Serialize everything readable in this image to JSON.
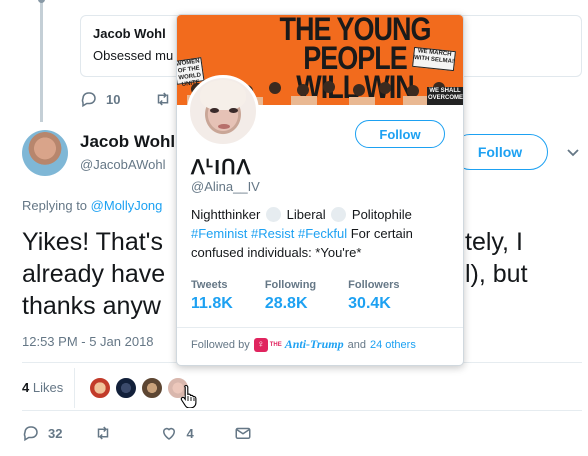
{
  "quoted_tweet": {
    "author": "Jacob Wohl",
    "text": "Obsessed mu"
  },
  "top_actions": {
    "replies": "10"
  },
  "tweet": {
    "author_name": "Jacob Wohl",
    "author_handle": "@JacobAWohl",
    "follow_label": "Follow",
    "replying_prefix": "Replying to",
    "replying_to": "@MollyJong",
    "text": "Yikes! That's tely, I already have l), but thanks anyway",
    "text_line1": "Yikes! That's",
    "text_line1_end": "tely, I",
    "text_line2": "already have",
    "text_line2_end": "l), but",
    "text_line3": "thanks anyw",
    "timestamp": "12:53 PM - 5 Jan 2018",
    "likes_count": "4",
    "likes_label": "Likes",
    "reply_count": "32",
    "like_count": "4"
  },
  "hover_card": {
    "banner_title_line1": "THE YOUNG",
    "banner_title_line2": "PEOPLE",
    "banner_title_line3": "WILL WIN",
    "banner_signs": [
      "WOMEN OF THE WORLD UNITE",
      "WE MARCH WITH SELMA!",
      "WE SHALL OVERCOME"
    ],
    "follow_label": "Follow",
    "display_name": "ᐱᒻIᑎᐱ",
    "handle": "@Alina__IV",
    "bio_word1": "Nightthinker",
    "bio_word2": "Liberal",
    "bio_word3": "Politophile",
    "bio_tag1": "#Feminist",
    "bio_tag2": "#Resist",
    "bio_tag3": "#Feckful",
    "bio_rest": "For certain confused individuals: *You're*",
    "stats": [
      {
        "label": "Tweets",
        "value": "11.8K"
      },
      {
        "label": "Following",
        "value": "28.8K"
      },
      {
        "label": "Followers",
        "value": "30.4K"
      }
    ],
    "followed_by_prefix": "Followed by",
    "followed_by_the": "THE",
    "followed_by_name": "Anti-Trump",
    "followed_by_and": "and",
    "followed_by_others": "24 others"
  },
  "colors": {
    "accent": "#1da1f2",
    "banner": "#f26b1d",
    "text_secondary": "#657786"
  }
}
